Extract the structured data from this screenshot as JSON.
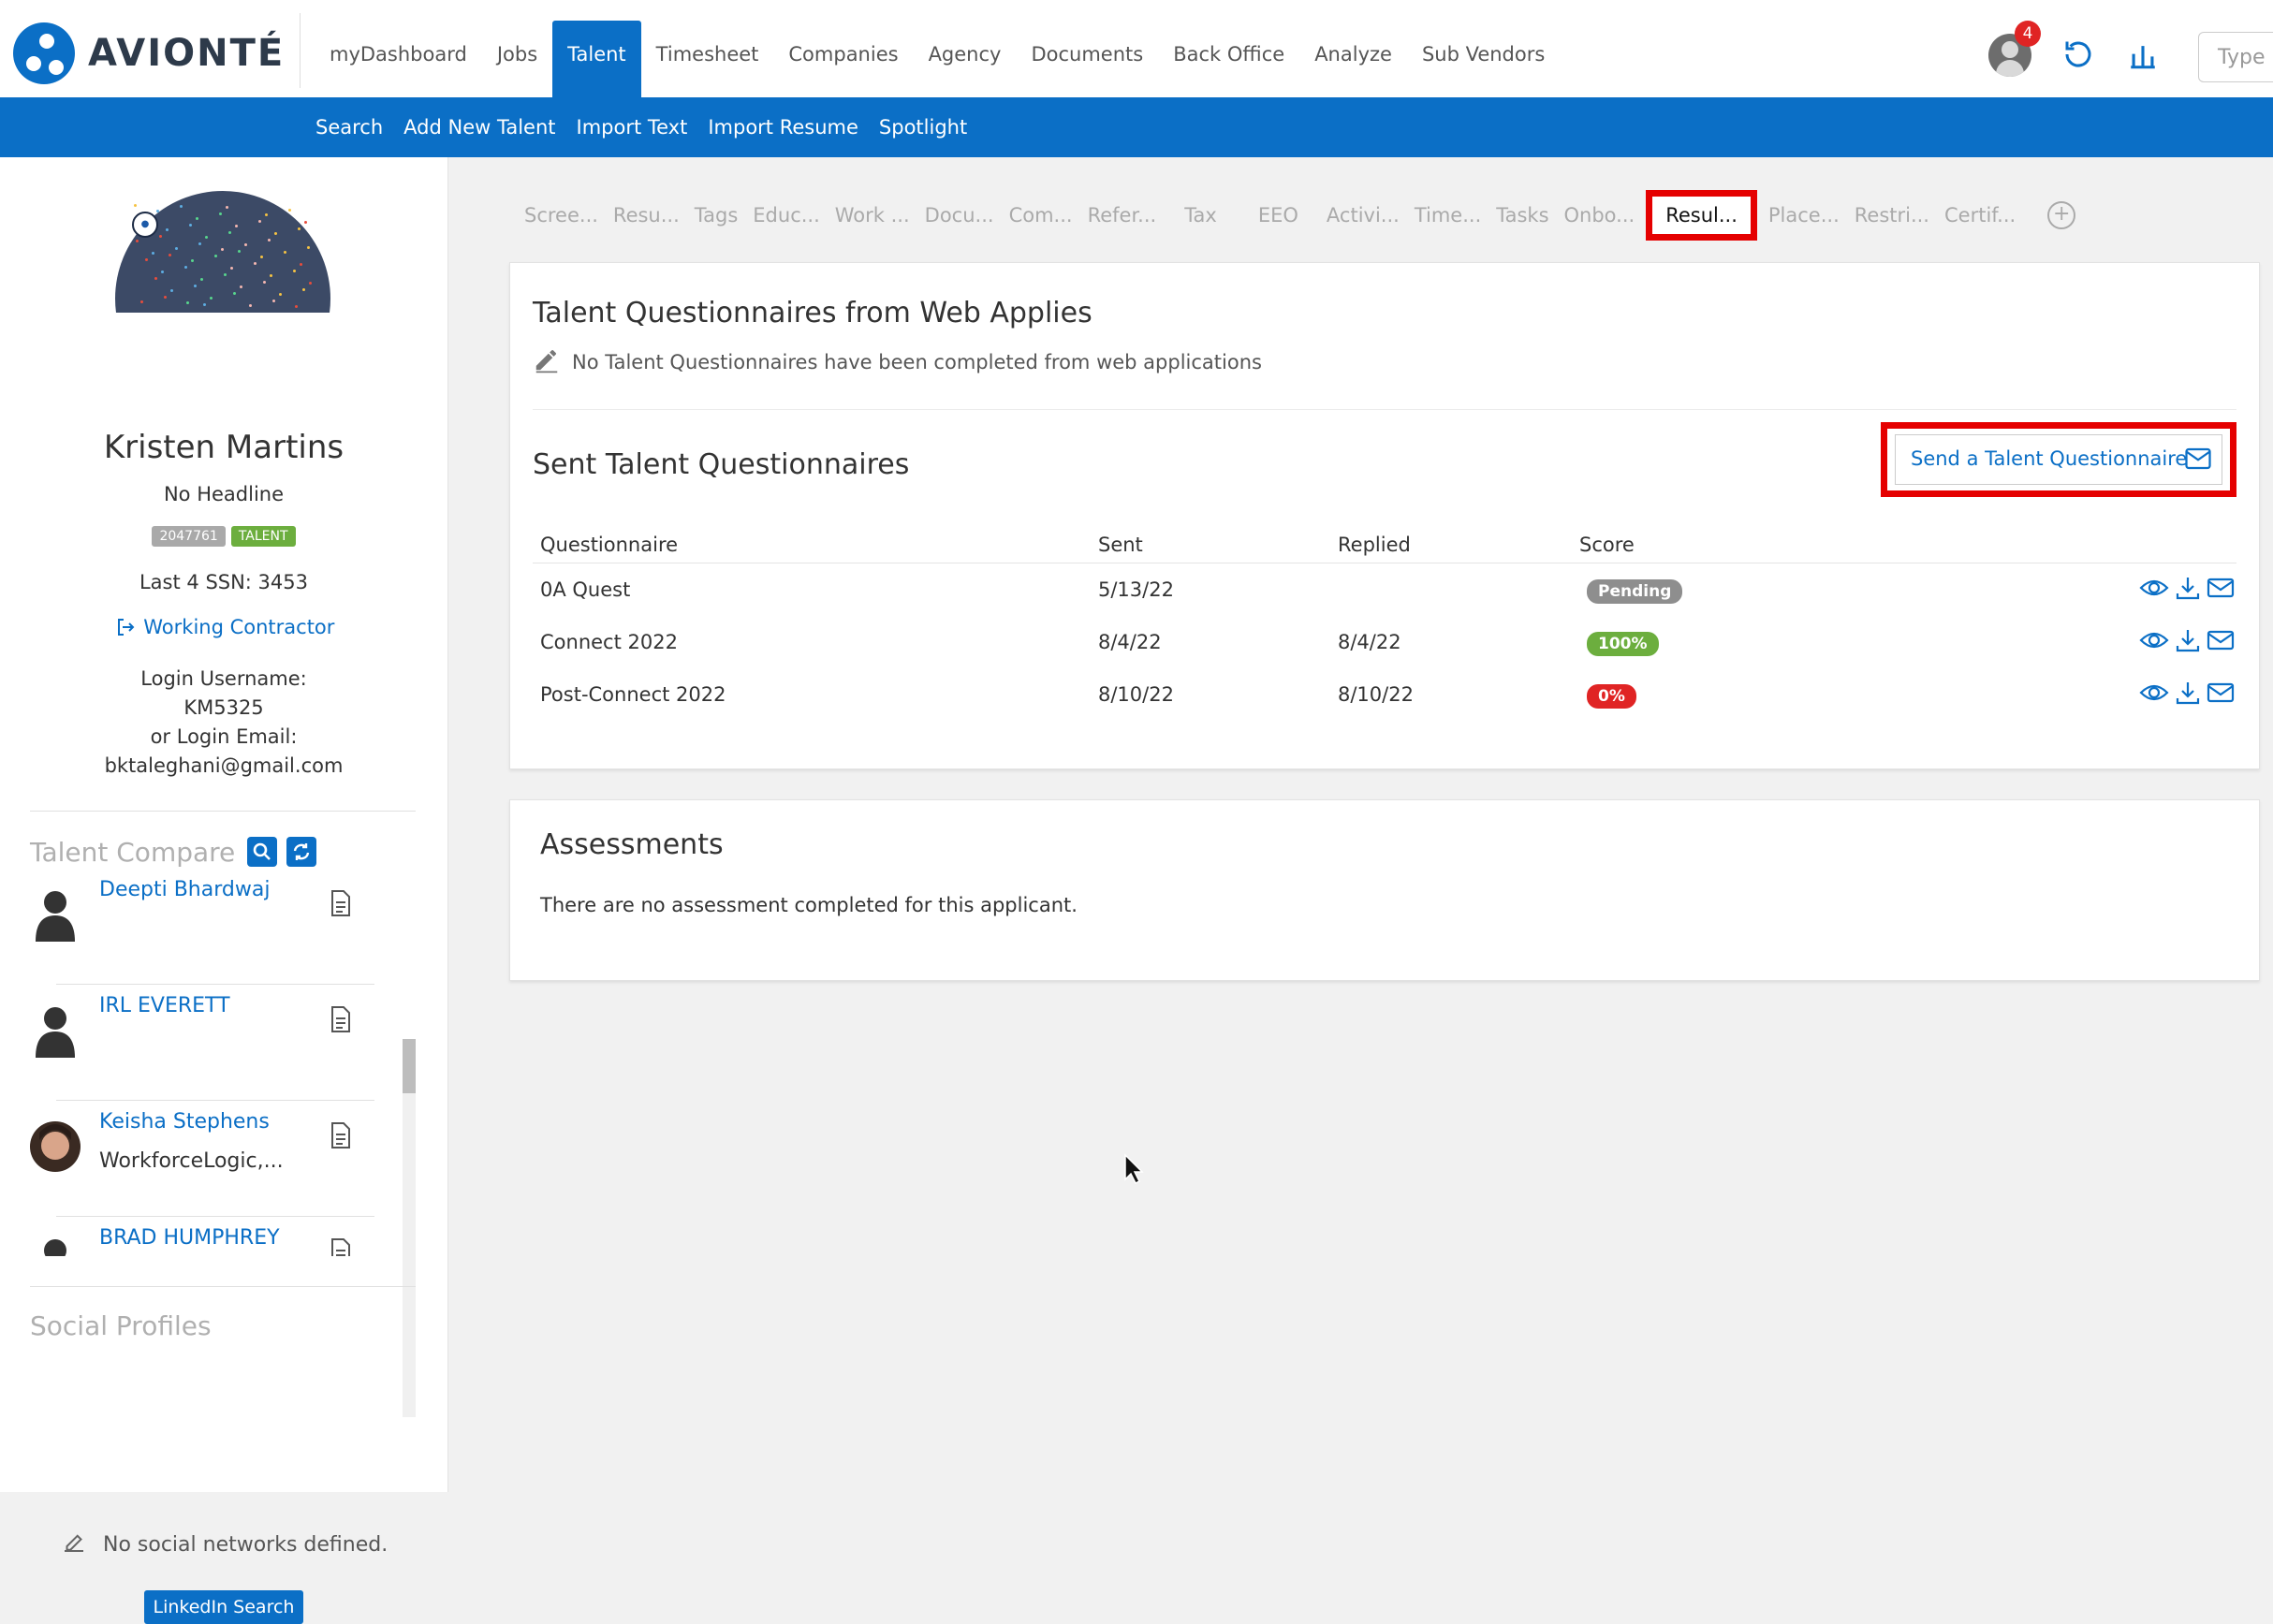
{
  "brand": {
    "name": "AVIONTÉ",
    "color": "#0b6fc6"
  },
  "nav": {
    "items": [
      {
        "label": "myDashboard",
        "active": false
      },
      {
        "label": "Jobs",
        "active": false
      },
      {
        "label": "Talent",
        "active": true
      },
      {
        "label": "Timesheet",
        "active": false
      },
      {
        "label": "Companies",
        "active": false
      },
      {
        "label": "Agency",
        "active": false
      },
      {
        "label": "Documents",
        "active": false
      },
      {
        "label": "Back Office",
        "active": false
      },
      {
        "label": "Analyze",
        "active": false
      },
      {
        "label": "Sub Vendors",
        "active": false
      }
    ],
    "notification_count": "4",
    "search_placeholder": "Type"
  },
  "subnav": {
    "items": [
      "Search",
      "Add New Talent",
      "Import Text",
      "Import Resume",
      "Spotlight"
    ]
  },
  "profile": {
    "name": "Kristen Martins",
    "headline": "No Headline",
    "id_tag": "2047761",
    "type_tag": "TALENT",
    "ssn": "Last 4 SSN: 3453",
    "status": "Working Contractor",
    "login_label": "Login Username:",
    "login_username": "KM5325",
    "email_label": "or Login Email:",
    "login_email": "bktaleghani@gmail.com"
  },
  "talent_compare": {
    "title": "Talent Compare",
    "items": [
      {
        "name": "Deepti Bhardwaj",
        "sub": ""
      },
      {
        "name": "IRL EVERETT",
        "sub": ""
      },
      {
        "name": "Keisha Stephens",
        "sub": "WorkforceLogic,..."
      },
      {
        "name": "BRAD HUMPHREY",
        "sub": ""
      }
    ]
  },
  "social": {
    "title": "Social Profiles",
    "empty": "No social networks defined.",
    "linkedin_button": "LinkedIn Search"
  },
  "tabs": [
    "Scree...",
    "Resu...",
    "Tags",
    "Educ...",
    "Work ...",
    "Docu...",
    "Com...",
    "Refer...",
    "Tax",
    "EEO",
    "Activi...",
    "Time...",
    "Tasks",
    "Onbo...",
    "Resul...",
    "Place...",
    "Restri...",
    "Certif..."
  ],
  "active_tab": "Resul...",
  "web_questionnaires": {
    "title": "Talent Questionnaires from Web Applies",
    "empty": "No Talent Questionnaires have been completed from web applications"
  },
  "sent_questionnaires": {
    "title": "Sent Talent Questionnaires",
    "send_button": "Send a Talent Questionnaire",
    "columns": [
      "Questionnaire",
      "Sent",
      "Replied",
      "Score"
    ],
    "rows": [
      {
        "name": "0A Quest",
        "sent": "5/13/22",
        "replied": "",
        "score": "Pending",
        "score_color": "#8e8e8e"
      },
      {
        "name": "Connect 2022",
        "sent": "8/4/22",
        "replied": "8/4/22",
        "score": "100%",
        "score_color": "#6cae3e"
      },
      {
        "name": "Post-Connect 2022",
        "sent": "8/10/22",
        "replied": "8/10/22",
        "score": "0%",
        "score_color": "#e02424"
      }
    ]
  },
  "assessments": {
    "title": "Assessments",
    "empty": "There are no assessment completed for this applicant."
  }
}
